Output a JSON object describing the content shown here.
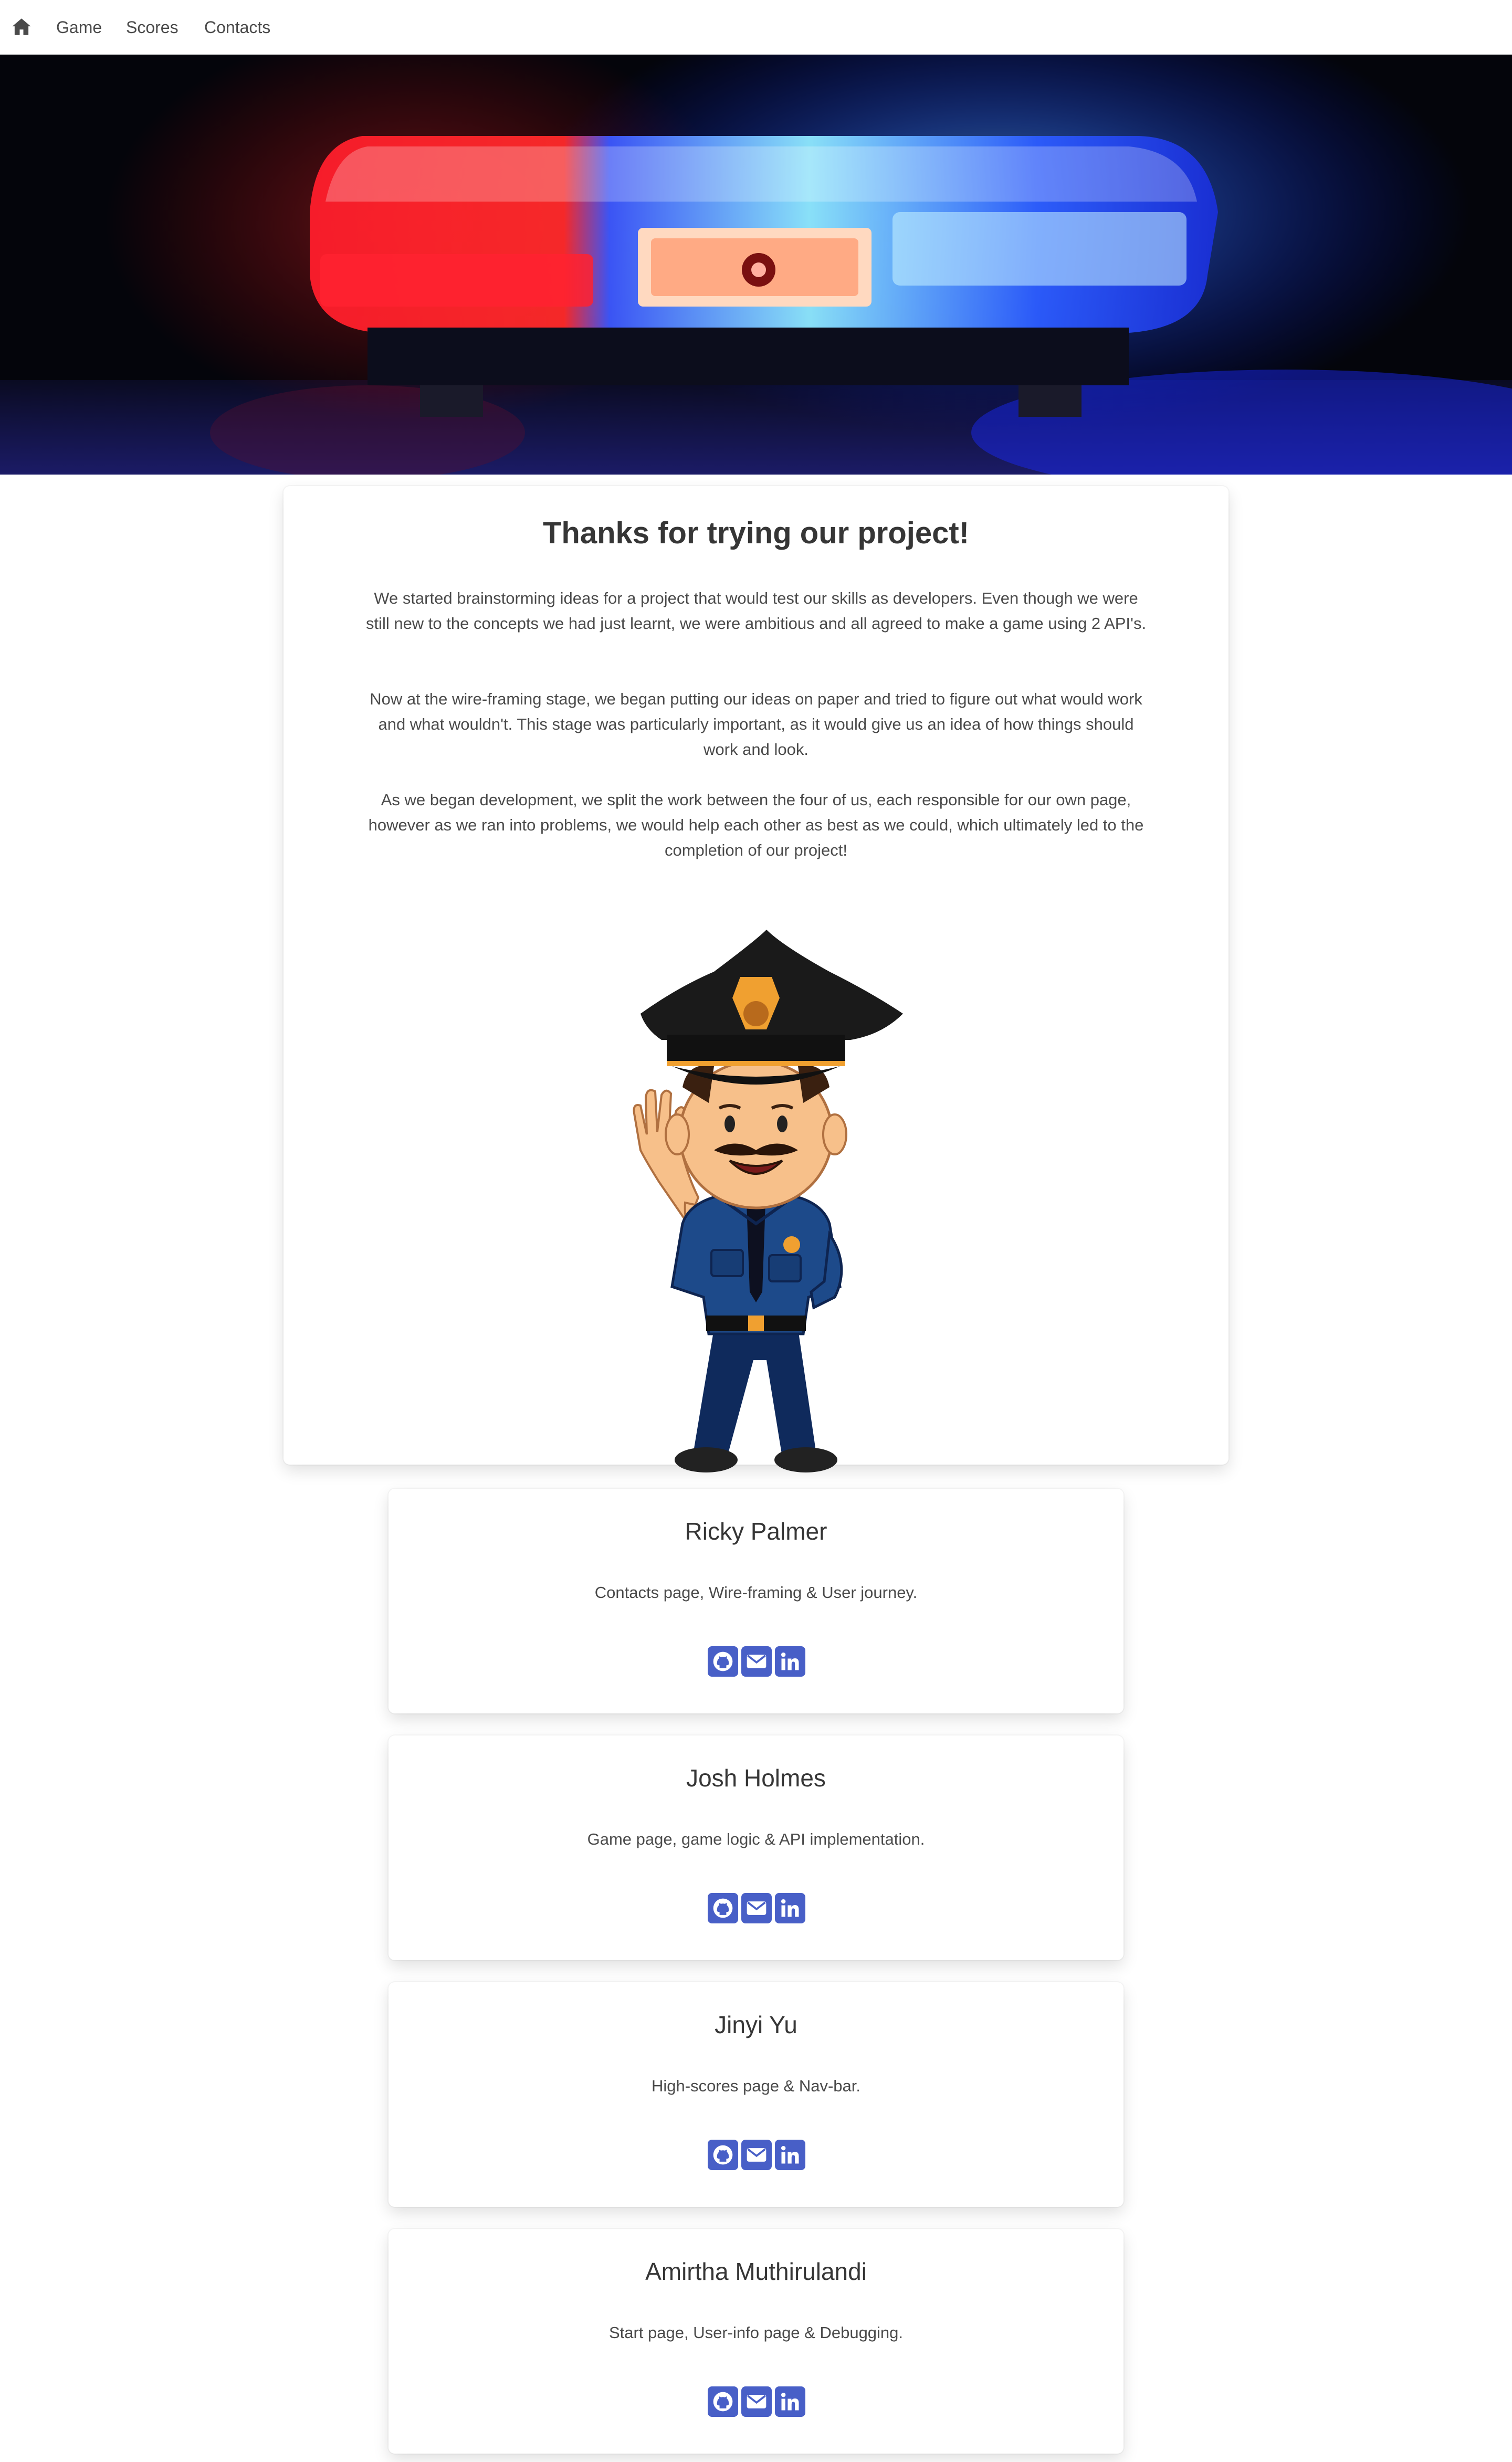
{
  "nav": {
    "home_icon": "home-icon",
    "links": [
      "Game",
      "Scores",
      "Contacts"
    ]
  },
  "hero": {
    "image": "police-light-bar-photo"
  },
  "about": {
    "title": "Thanks for trying our project!",
    "paragraphs": [
      "We started brainstorming ideas for a project that would test our skills as developers. Even though we were still new to the concepts we had just learnt, we were ambitious and all agreed to make a game using 2 API's.",
      "Now at the wire-framing stage, we began putting our ideas on paper and tried to figure out what would work and what wouldn't. This stage was particularly important, as it would give us an idea of how things should work and look.",
      "As we began development, we split the work between the four of us, each responsible for our own page, however as we ran into problems, we would help each other as best as we could, which ultimately led to the completion of our project!"
    ],
    "illustration": "cartoon-police-officer-waving"
  },
  "team": [
    {
      "name": "Ricky Palmer",
      "role": "Contacts page, Wire-framing & User journey."
    },
    {
      "name": "Josh Holmes",
      "role": "Game page, game logic & API implementation."
    },
    {
      "name": "Jinyi Yu",
      "role": "High-scores page & Nav-bar."
    },
    {
      "name": "Amirtha Muthirulandi",
      "role": "Start page, User-info page & Debugging."
    }
  ],
  "social_icons": [
    "github-icon",
    "email-icon",
    "linkedin-icon"
  ],
  "colors": {
    "accent": "#485fc7",
    "text": "#363636",
    "muted": "#4a4a4a"
  }
}
